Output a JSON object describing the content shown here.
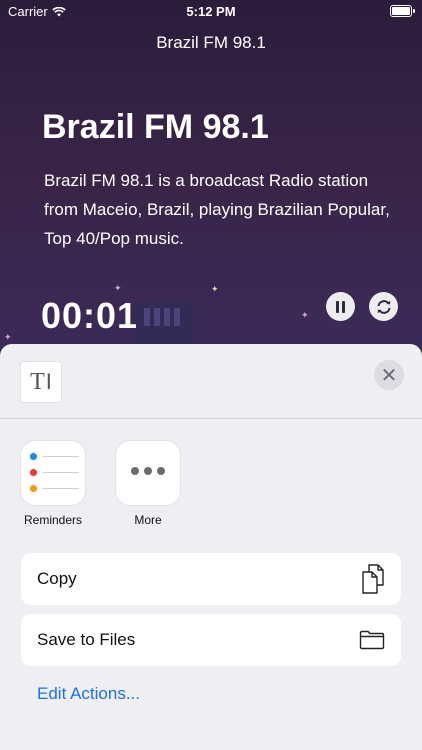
{
  "status_bar": {
    "carrier": "Carrier",
    "time": "5:12 PM"
  },
  "player": {
    "header_title": "Brazil FM 98.1",
    "station_name": "Brazil FM 98.1",
    "description": "Brazil FM 98.1 is a broadcast Radio station from Maceio, Brazil, playing Brazilian Popular, Top 40/Pop music.",
    "elapsed": "00:01",
    "controls": [
      "pause-icon",
      "refresh-icon"
    ]
  },
  "share_sheet": {
    "preview_glyph": "T",
    "apps": [
      {
        "label": "Reminders",
        "icon": "reminders-icon"
      },
      {
        "label": "More",
        "icon": "more-icon"
      }
    ],
    "actions": [
      {
        "label": "Copy",
        "icon": "copy-icon"
      },
      {
        "label": "Save to Files",
        "icon": "folder-icon"
      }
    ],
    "edit_actions": "Edit Actions..."
  },
  "colors": {
    "link": "#1a73e8",
    "sheet_bg": "#eeeef3",
    "reminder_blue": "#1e88e5",
    "reminder_red": "#e53935",
    "reminder_orange": "#f39c12"
  }
}
